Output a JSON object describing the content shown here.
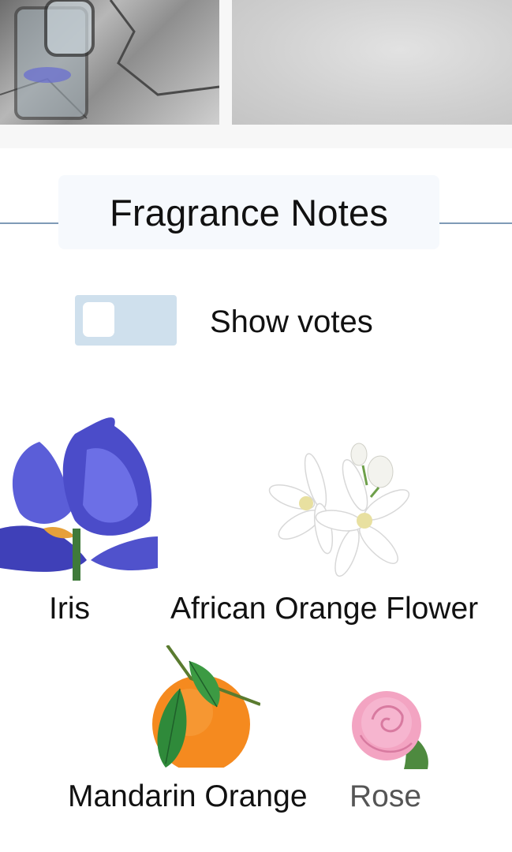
{
  "section": {
    "title": "Fragrance Notes"
  },
  "toggle": {
    "label": "Show votes",
    "on": false
  },
  "notes": [
    {
      "name": "Iris",
      "icon": "iris-flower-icon"
    },
    {
      "name": "African Orange Flower",
      "icon": "orange-blossom-icon"
    },
    {
      "name": "Mandarin Orange",
      "icon": "mandarin-orange-icon"
    },
    {
      "name": "Rose",
      "icon": "rose-icon"
    }
  ],
  "colors": {
    "rule": "#7f9bb6",
    "header_bg": "#f6f9fd",
    "toggle_bg": "#cfe0ed"
  }
}
